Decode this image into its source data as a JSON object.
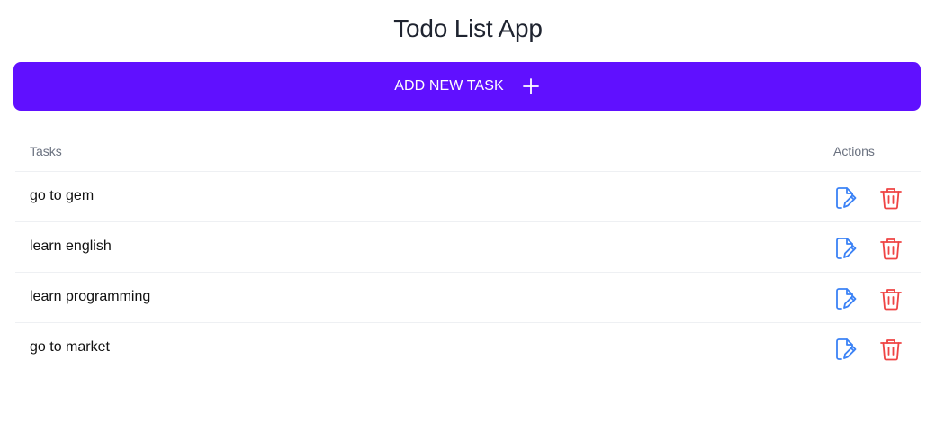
{
  "app": {
    "title": "Todo List App"
  },
  "add_button": {
    "label": "ADD NEW TASK",
    "icon": "plus-icon"
  },
  "table": {
    "headers": {
      "tasks": "Tasks",
      "actions": "Actions"
    },
    "rows": [
      {
        "task": "go to gem"
      },
      {
        "task": "learn english"
      },
      {
        "task": "learn programming"
      },
      {
        "task": "go to market"
      }
    ],
    "row_icons": {
      "edit": "edit-icon",
      "delete": "trash-icon"
    }
  },
  "colors": {
    "accent": "#6010ff",
    "edit_icon": "#3b82f6",
    "delete_icon": "#ef4444",
    "divider": "#eef0f3"
  }
}
